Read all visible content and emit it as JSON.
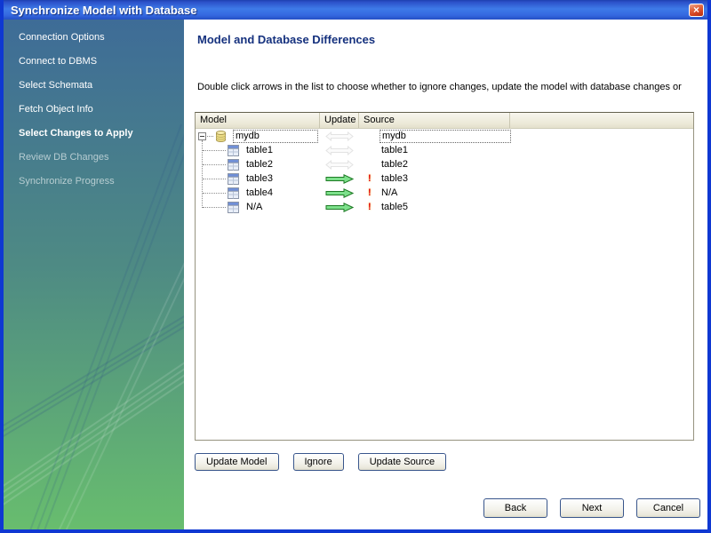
{
  "window": {
    "title": "Synchronize Model with Database",
    "close_icon": "×"
  },
  "sidebar": {
    "steps": [
      {
        "label": "Connection Options",
        "state": "done"
      },
      {
        "label": "Connect to DBMS",
        "state": "done"
      },
      {
        "label": "Select Schemata",
        "state": "done"
      },
      {
        "label": "Fetch Object Info",
        "state": "done"
      },
      {
        "label": "Select Changes to Apply",
        "state": "active"
      },
      {
        "label": "Review DB Changes",
        "state": "pending"
      },
      {
        "label": "Synchronize Progress",
        "state": "pending"
      }
    ]
  },
  "main": {
    "heading": "Model and Database Differences",
    "instruction": "Double click arrows in the list to choose whether to ignore changes, update the model with database changes or",
    "diff_list": {
      "columns": [
        "Model",
        "Update",
        "Source"
      ],
      "alert_icon": "!",
      "rows": [
        {
          "model": "mydb",
          "model_icon": "database-icon",
          "arrow": "both",
          "arrow_icon": "sync-both-arrow-icon",
          "source": "mydb",
          "source_alert": false,
          "selected": true,
          "level": 0
        },
        {
          "model": "table1",
          "model_icon": "table-icon",
          "arrow": "both",
          "arrow_icon": "sync-both-arrow-icon",
          "source": "table1",
          "source_alert": false,
          "selected": false,
          "level": 1
        },
        {
          "model": "table2",
          "model_icon": "table-icon",
          "arrow": "both",
          "arrow_icon": "sync-both-arrow-icon",
          "source": "table2",
          "source_alert": false,
          "selected": false,
          "level": 1
        },
        {
          "model": "table3",
          "model_icon": "table-icon",
          "arrow": "right",
          "arrow_icon": "update-source-arrow-icon",
          "source": "table3",
          "source_alert": true,
          "selected": false,
          "level": 1
        },
        {
          "model": "table4",
          "model_icon": "table-icon",
          "arrow": "right",
          "arrow_icon": "update-source-arrow-icon",
          "source": "N/A",
          "source_alert": true,
          "selected": false,
          "level": 1
        },
        {
          "model": "N/A",
          "model_icon": "table-icon",
          "arrow": "right",
          "arrow_icon": "update-source-arrow-icon",
          "source": "table5",
          "source_alert": true,
          "selected": false,
          "level": 1
        }
      ]
    },
    "action_buttons": [
      "Update Model",
      "Ignore",
      "Update Source"
    ],
    "footer_buttons": [
      "Back",
      "Next",
      "Cancel"
    ]
  },
  "colors": {
    "window_border": "#0f38d2",
    "titlebar_top": "#2b50c8",
    "titlebar_mid": "#3e7ae8",
    "close_button_red": "#d14220",
    "sidebar_top": "#3e6c97",
    "sidebar_mid": "#4e8a84",
    "sidebar_bottom": "#68bd6e",
    "heading": "#15317e",
    "header_bg": "#ece9d8",
    "arrow_green": "#7de08b",
    "arrow_green_border": "#1d7a24",
    "alert_red": "#e00000"
  }
}
